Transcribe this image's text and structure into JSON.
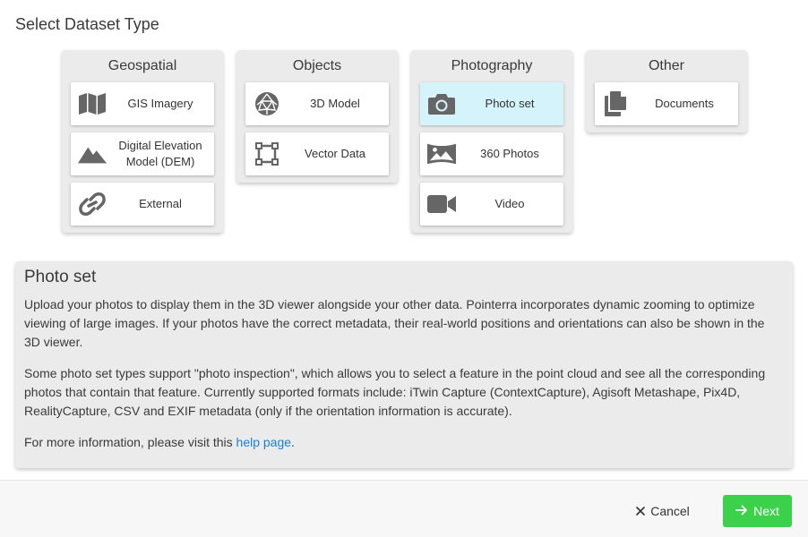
{
  "page": {
    "title": "Select Dataset Type"
  },
  "categories": [
    {
      "title": "Geospatial",
      "items": [
        {
          "label": "GIS Imagery",
          "icon": "map-icon"
        },
        {
          "label": "Digital Elevation Model (DEM)",
          "icon": "mountain-icon"
        },
        {
          "label": "External",
          "icon": "link-icon"
        }
      ]
    },
    {
      "title": "Objects",
      "items": [
        {
          "label": "3D Model",
          "icon": "polyhedron-icon"
        },
        {
          "label": "Vector Data",
          "icon": "vector-square-icon"
        }
      ]
    },
    {
      "title": "Photography",
      "items": [
        {
          "label": "Photo set",
          "icon": "camera-icon",
          "selected": true
        },
        {
          "label": "360 Photos",
          "icon": "panorama-icon"
        },
        {
          "label": "Video",
          "icon": "video-camera-icon"
        }
      ]
    },
    {
      "title": "Other",
      "items": [
        {
          "label": "Documents",
          "icon": "copy-documents-icon"
        }
      ]
    }
  ],
  "info": {
    "title": "Photo set",
    "paragraph1": "Upload your photos to display them in the 3D viewer alongside your other data. Pointerra incorporates dynamic zooming to optimize viewing of large images. If your photos have the correct metadata, their real-world positions and orientations can also be shown in the 3D viewer.",
    "paragraph2": "Some photo set types support \"photo inspection\", which allows you to select a feature in the point cloud and see all the corresponding photos that contain that feature. Currently supported formats include: iTwin Capture (ContextCapture), Agisoft Metashape, Pix4D, RealityCapture, CSV and EXIF metadata (only if the orientation information is accurate).",
    "more_info_prefix": "For more information, please visit this ",
    "help_link_label": "help page",
    "more_info_suffix": "."
  },
  "footer": {
    "cancel_label": "Cancel",
    "next_label": "Next"
  },
  "colors": {
    "selected_tile": "#d5f3fb",
    "next_button": "#3bd14b",
    "link": "#1a7fd4",
    "panel": "#ebebeb"
  }
}
